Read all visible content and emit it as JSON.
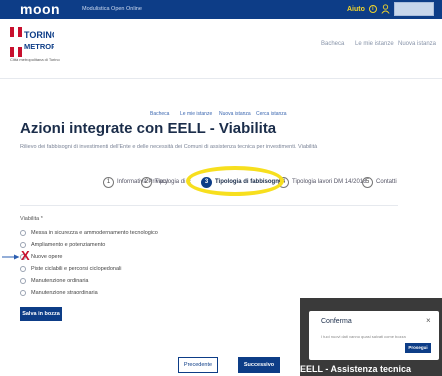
{
  "topbar": {
    "brand": "moon",
    "brand_sub": "Modulistica Open Online",
    "help_label": "Aiuto",
    "help_icon": "info-circle-icon",
    "user_icon": "user-icon"
  },
  "header": {
    "logo_text_line1": "TORINO",
    "logo_text_line2": "METROPOLI",
    "logo_caption": "Città metropolitana di Torino",
    "nav": [
      "Bacheca",
      "Le mie istanze",
      "Nuova istanza"
    ]
  },
  "breadcrumb": [
    "Bacheca",
    "Le mie istanze",
    "Nuova istanza",
    "Cerca istanza"
  ],
  "page": {
    "title": "Azioni integrate con EELL - Viabilita",
    "subtitle": "Rilievo dei fabbisogni di investimenti dell'Ente e delle necessità dei Comuni di assistenza tecnica per investimenti. Viabilità"
  },
  "steps": [
    {
      "num": "1",
      "label": "Informativa Privacy"
    },
    {
      "num": "2",
      "label": "Tipologia di E"
    },
    {
      "num": "3",
      "label": "Tipologia di fabbisogno"
    },
    {
      "num": "4",
      "label": "Tipologia lavori DM 14/2018"
    },
    {
      "num": "5",
      "label": "Contatti"
    }
  ],
  "form": {
    "field_label": "Viabilita *",
    "options": [
      "Messa in sicurezza e ammodernamento tecnologico",
      "Ampliamento e potenziamento",
      "Nuove opere",
      "Piste ciclabili e percorsi ciclopedonali",
      "Manutenzione ordinaria",
      "Manutenzione straordinaria"
    ],
    "marked_option": "x-mark"
  },
  "buttons": {
    "save": "Salva in bozza",
    "previous": "Precedente",
    "next": "Successivo"
  },
  "modal": {
    "title": "Conferma",
    "body": "I tuoi nuovi dati vanno quasi salvati come bozza",
    "proceed": "Prosegui",
    "close_icon": "close-icon"
  },
  "background_text": "EELL - Assistenza tecnica",
  "colors": {
    "primary": "#0d3d87",
    "help": "#f2d52a",
    "highlight": "#f7df1e",
    "mark": "#c8102e"
  }
}
